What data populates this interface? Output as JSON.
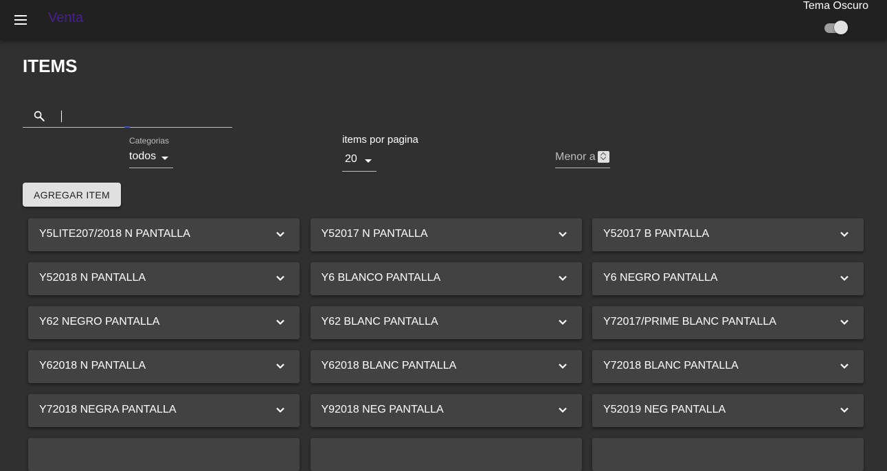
{
  "header": {
    "app_title": "Venta",
    "theme_label": "Tema Oscuro",
    "theme_dark_enabled": true
  },
  "page": {
    "title": "ITEMS"
  },
  "search": {
    "value": "",
    "placeholder": ""
  },
  "filters": {
    "category_label": "Categorias",
    "category_value": "todos",
    "items_per_page_label": "items por pagina",
    "items_per_page_value": "20",
    "less_than_placeholder": "Menor a"
  },
  "actions": {
    "add_item_label": "AGREGAR ITEM"
  },
  "items": [
    {
      "label": "Y5LITE207/2018 N PANTALLA"
    },
    {
      "label": "Y52017 N PANTALLA"
    },
    {
      "label": "Y52017 B PANTALLA"
    },
    {
      "label": "Y52018 N PANTALLA"
    },
    {
      "label": "Y6 BLANCO PANTALLA"
    },
    {
      "label": "Y6 NEGRO PANTALLA"
    },
    {
      "label": "Y62 NEGRO PANTALLA"
    },
    {
      "label": "Y62 BLANC PANTALLA"
    },
    {
      "label": "Y72017/PRIME BLANC PANTALLA"
    },
    {
      "label": "Y62018 N PANTALLA"
    },
    {
      "label": "Y62018 BLANC PANTALLA"
    },
    {
      "label": "Y72018 BLANC PANTALLA"
    },
    {
      "label": "Y72018 NEGRA PANTALLA"
    },
    {
      "label": "Y92018 NEG PANTALLA"
    },
    {
      "label": "Y52019 NEG PANTALLA"
    },
    {
      "label": ""
    },
    {
      "label": ""
    },
    {
      "label": ""
    }
  ],
  "icons": {
    "menu": "menu-icon",
    "search": "search-icon",
    "dropdown": "arrow-drop-down-icon",
    "expand": "chevron-down-icon"
  },
  "colors": {
    "background": "#303030",
    "topbar": "#212121",
    "card": "#424242",
    "brand": "#4a1f8f",
    "button": "#e0e0e0"
  }
}
